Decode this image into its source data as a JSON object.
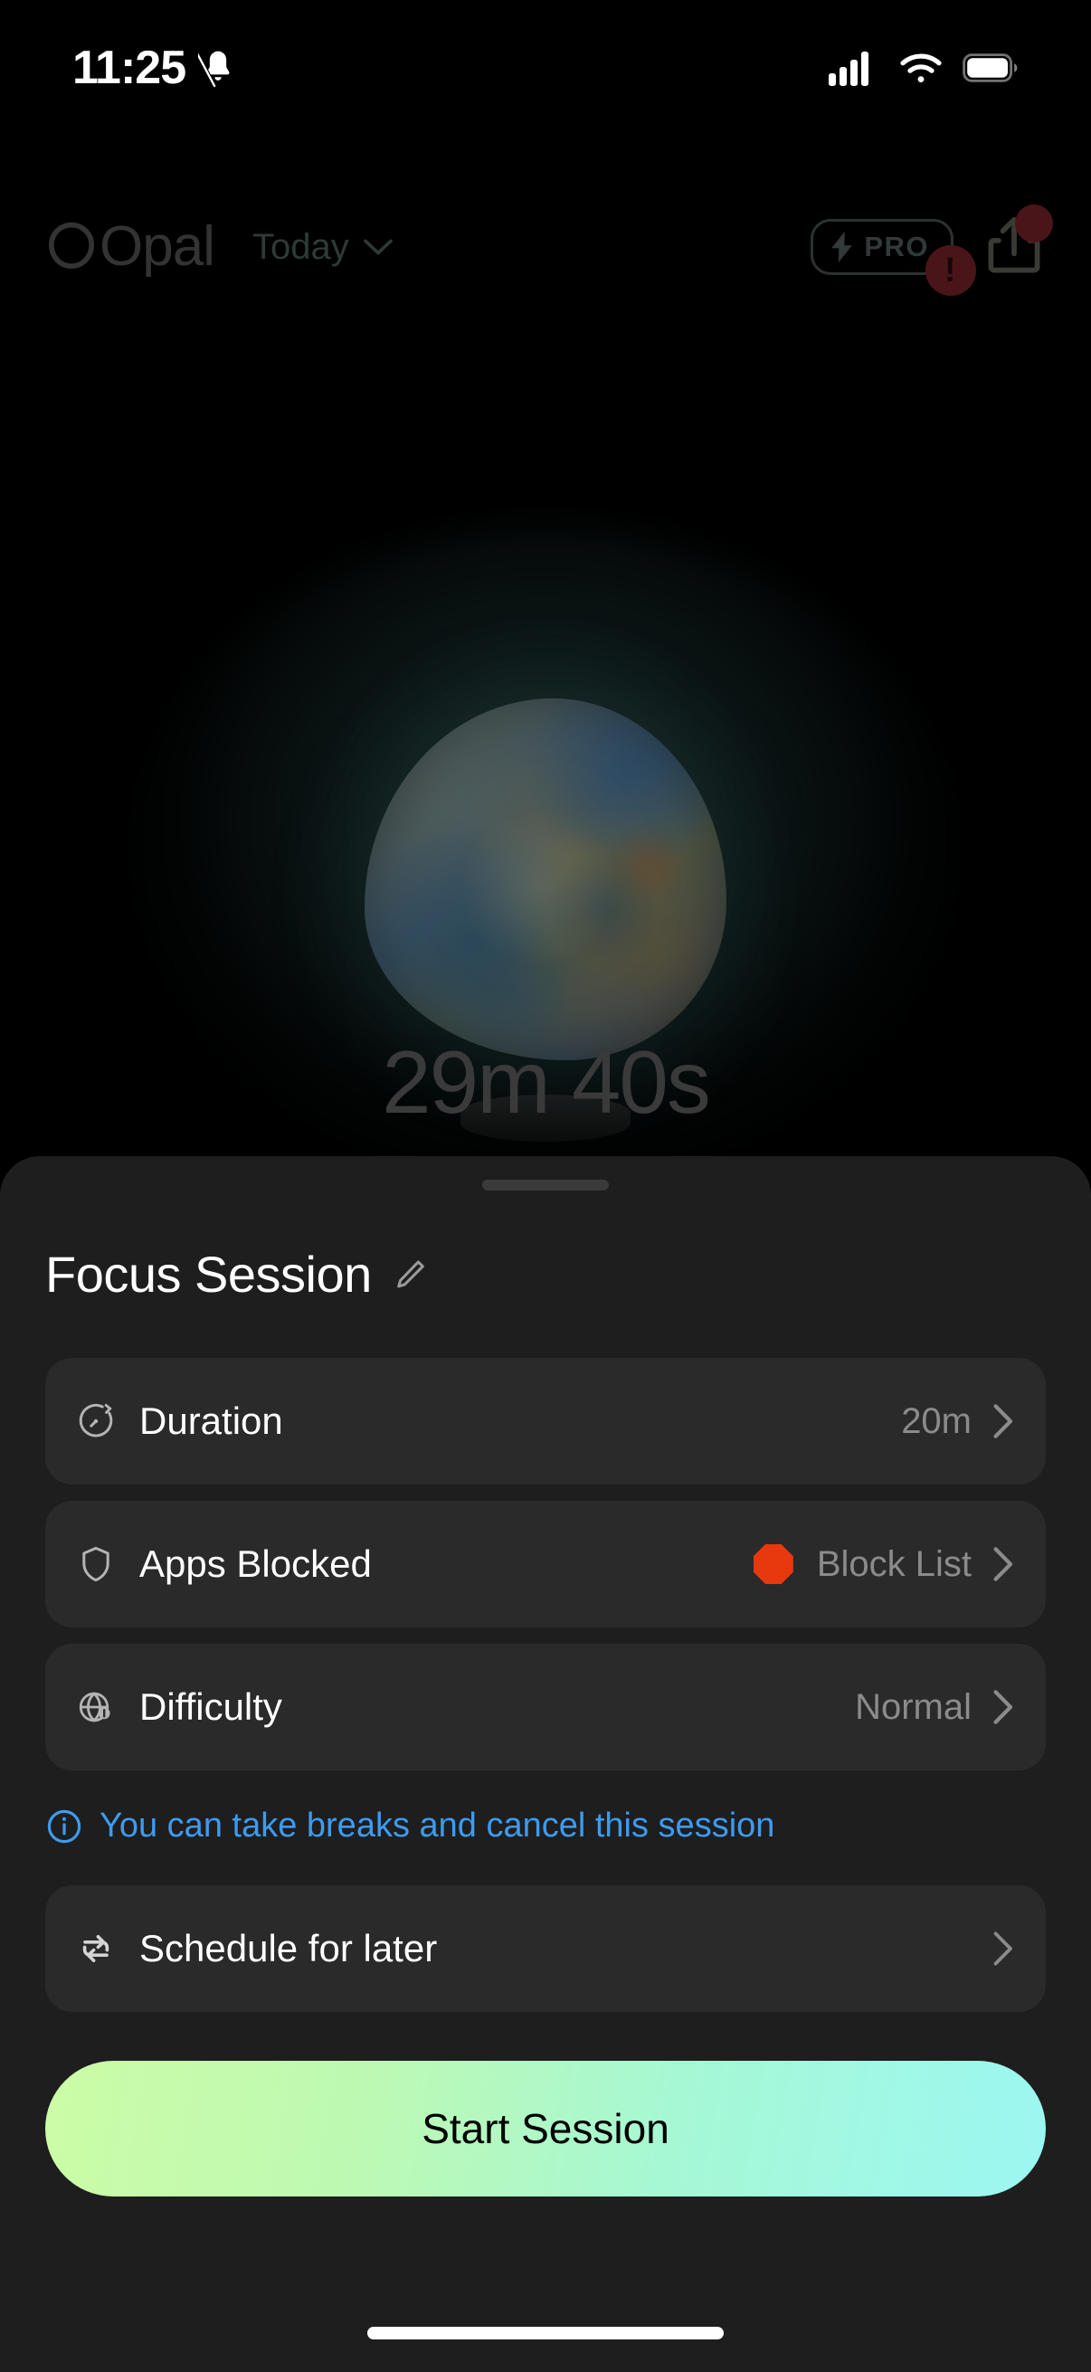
{
  "status_bar": {
    "time": "11:25",
    "icons": [
      "bell-slash-icon",
      "cellular-signal-icon",
      "wifi-icon",
      "battery-icon"
    ]
  },
  "header": {
    "logo_text": "Opal",
    "day_selector": "Today",
    "chevron_icon": "chevron-down-icon",
    "pro_badge": {
      "label": "PRO",
      "bolt_icon": "lightning-bolt-icon",
      "alert": "!"
    },
    "share_icon": "share-icon"
  },
  "orb": {
    "icon": "opal-stone-lamp"
  },
  "timer": {
    "remaining": "29m 40s"
  },
  "sheet": {
    "title": "Focus Session",
    "edit_icon": "pencil-icon",
    "grabber": "drag-handle",
    "rows": [
      {
        "icon": "stopwatch-icon",
        "label": "Duration",
        "value": "20m",
        "chevron": "chevron-right-icon",
        "emoji": null
      },
      {
        "icon": "shield-icon",
        "label": "Apps Blocked",
        "value": "Block List",
        "chevron": "chevron-right-icon",
        "emoji": "stop-sign-emoji"
      },
      {
        "icon": "globe-icon",
        "label": "Difficulty",
        "value": "Normal",
        "chevron": "chevron-right-icon",
        "emoji": null
      }
    ],
    "note": {
      "icon": "info-circle-icon",
      "text": "You can take breaks and cancel this session",
      "color": "#3d9bf0"
    },
    "schedule": {
      "icon": "repeat-icon",
      "label": "Schedule for later",
      "chevron": "chevron-right-icon"
    },
    "cta": {
      "label": "Start Session",
      "gradient_start": "#ccfca6",
      "gradient_end": "#9cf7f2"
    }
  },
  "home_indicator": "home-indicator"
}
